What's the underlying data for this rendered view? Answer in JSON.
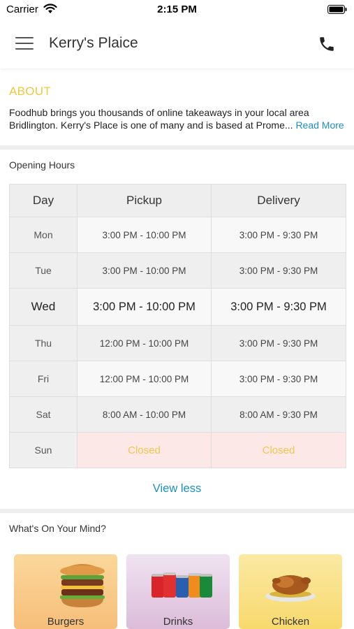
{
  "status_bar": {
    "carrier": "Carrier",
    "time": "2:15 PM"
  },
  "header": {
    "title": "Kerry's Plaice"
  },
  "about": {
    "title": "ABOUT",
    "line1": "Foodhub brings you thousands of online takeaways in your local area",
    "line2": "Bridlington. Kerry's Place is one of many and is based at Prome...",
    "read_more": "Read More"
  },
  "hours": {
    "title": "Opening Hours",
    "columns": [
      "Day",
      "Pickup",
      "Delivery"
    ],
    "rows": [
      {
        "day": "Mon",
        "pickup": "3:00 PM - 10:00 PM",
        "delivery": "3:00 PM - 9:30 PM"
      },
      {
        "day": "Tue",
        "pickup": "3:00 PM - 10:00 PM",
        "delivery": "3:00 PM - 9:30 PM"
      },
      {
        "day": "Wed",
        "pickup": "3:00 PM - 10:00 PM",
        "delivery": "3:00 PM - 9:30 PM"
      },
      {
        "day": "Thu",
        "pickup": "12:00 PM - 10:00 PM",
        "delivery": "3:00 PM - 9:30 PM"
      },
      {
        "day": "Fri",
        "pickup": "12:00 PM - 10:00 PM",
        "delivery": "3:00 PM - 9:30 PM"
      },
      {
        "day": "Sat",
        "pickup": "8:00 AM - 10:00 PM",
        "delivery": "8:00 AM - 9:30 PM"
      },
      {
        "day": "Sun",
        "pickup": "Closed",
        "delivery": "Closed"
      }
    ],
    "view_less": "View less"
  },
  "categories": {
    "title": "What's On Your Mind?",
    "items": [
      {
        "label": "Burgers",
        "icon": "burger-icon"
      },
      {
        "label": "Drinks",
        "icon": "drinks-icon"
      },
      {
        "label": "Chicken",
        "icon": "chicken-icon"
      }
    ]
  },
  "colors": {
    "accent_yellow": "#f0c83c",
    "link_blue": "#1d8fbd",
    "closed_bg": "#fde8e8"
  }
}
